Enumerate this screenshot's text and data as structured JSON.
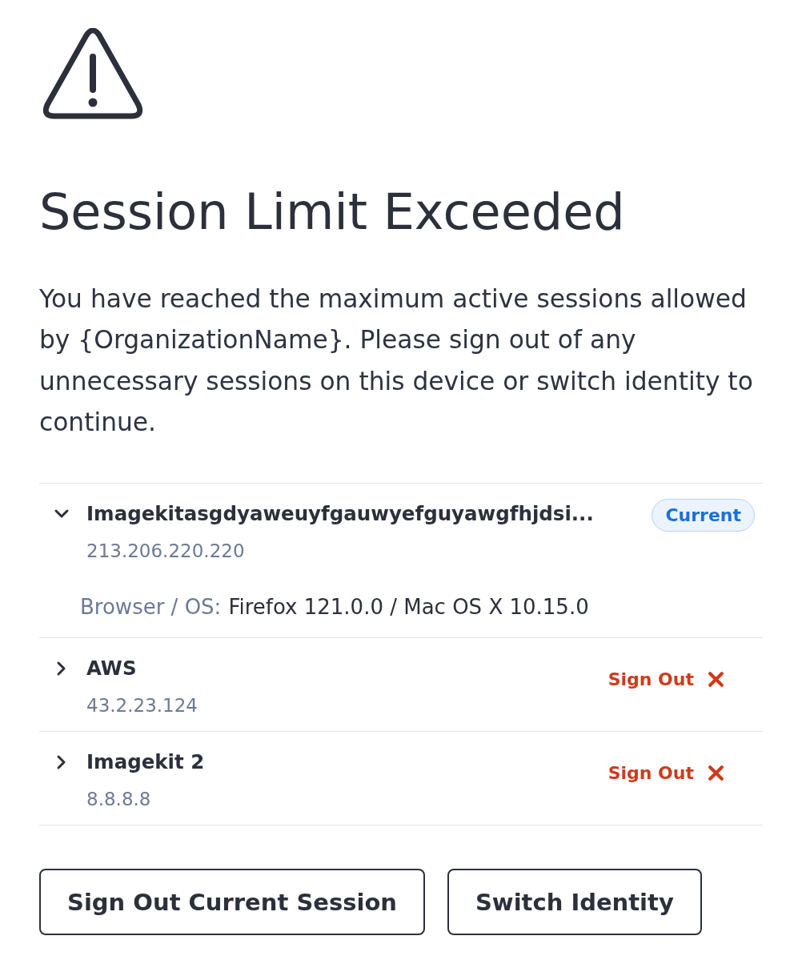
{
  "warning": {
    "title": "Session Limit Exceeded",
    "message": "You have reached the maximum active sessions allowed by {OrganizationName}. Please sign out of any unnecessary sessions on this device or switch identity to continue."
  },
  "sessions": [
    {
      "name": "Imagekitasgdyaweuyfgauwyefguyawgfhjdsi...",
      "ip": "213.206.220.220",
      "expanded": true,
      "current": true,
      "badge": "Current",
      "details": [
        {
          "label": "Browser / OS:",
          "value": "Firefox 121.0.0 / Mac OS X 10.15.0"
        }
      ]
    },
    {
      "name": "AWS",
      "ip": "43.2.23.124",
      "expanded": false,
      "current": false,
      "action": "Sign Out"
    },
    {
      "name": "Imagekit 2",
      "ip": "8.8.8.8",
      "expanded": false,
      "current": false,
      "action": "Sign Out"
    }
  ],
  "buttons": [
    {
      "label": "Sign Out Current Session"
    },
    {
      "label": "Switch Identity"
    }
  ]
}
